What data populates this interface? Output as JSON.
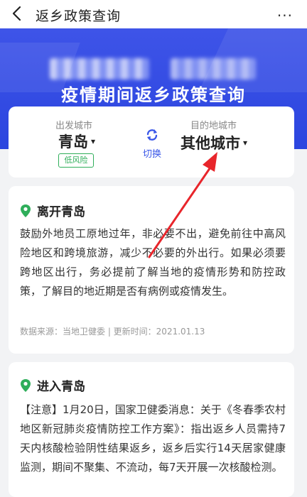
{
  "header": {
    "title": "返乡政策查询",
    "more": "···"
  },
  "banner": {
    "title": "疫情期间返乡政策查询"
  },
  "route": {
    "from_label": "出发城市",
    "from_city": "青岛",
    "from_risk": "低风险",
    "switch_label": "切换",
    "to_label": "目的地城市",
    "to_city": "其他城市"
  },
  "sections": [
    {
      "title": "离开青岛",
      "body": "鼓励外地员工原地过年，非必要不出，避免前往中高风险地区和跨境旅游，减少不必要的外出行。如果必须要跨地区出行，务必提前了解当地的疫情形势和防控政策，了解目的地近期是否有病例或疫情发生。",
      "meta": "数据来源：当地卫健委 | 更新时间：2021.01.13"
    },
    {
      "title": "进入青岛",
      "body": "【注意】1月20日，国家卫健委消息：关于《冬春季农村地区新冠肺炎疫情防控工作方案》：指出返乡人员需持7天内核酸检验阴性结果返乡，返乡后实行14天居家健康监测，期间不聚集、不流动，每7天开展一次核酸检测。"
    }
  ],
  "colors": {
    "brand": "#2b45df",
    "accent": "#3a57e8",
    "safe": "#2fae5a",
    "annotation": "#e8252b"
  }
}
